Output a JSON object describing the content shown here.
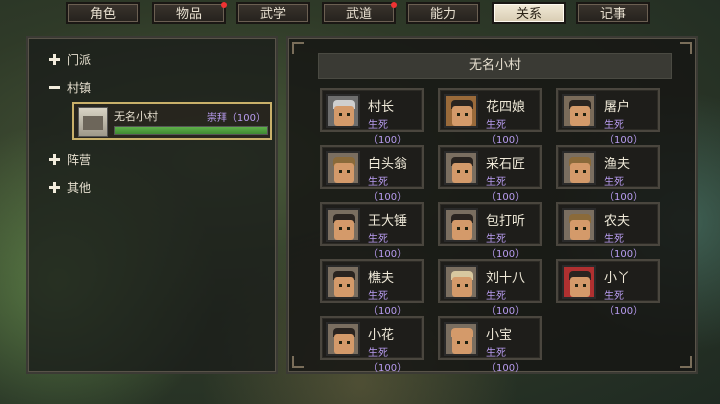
{
  "tabs": [
    {
      "label": "角色",
      "active": false,
      "dot": false
    },
    {
      "label": "物品",
      "active": false,
      "dot": true
    },
    {
      "label": "武学",
      "active": false,
      "dot": false
    },
    {
      "label": "武道",
      "active": false,
      "dot": true
    },
    {
      "label": "能力",
      "active": false,
      "dot": false
    },
    {
      "label": "关系",
      "active": true,
      "dot": false
    },
    {
      "label": "记事",
      "active": false,
      "dot": false
    }
  ],
  "tree": {
    "sect": "门派",
    "village": "村镇",
    "faction": "阵营",
    "other": "其他"
  },
  "village_card": {
    "name": "无名小村",
    "relation": "崇拜（100）",
    "progress": 1.0
  },
  "panel": {
    "title": "无名小村",
    "npcs": [
      {
        "name": "村长",
        "relation": "生死（100）",
        "portrait": "village-chief-portrait",
        "bg": "#6e6e6e",
        "hair": "#cfcfcf"
      },
      {
        "name": "花四娘",
        "relation": "生死（100）",
        "portrait": "hua-siniang-portrait",
        "bg": "#9a6a3a",
        "hair": "#2a2420"
      },
      {
        "name": "屠户",
        "relation": "生死（100）",
        "portrait": "butcher-portrait",
        "bg": "#7a6b5a",
        "hair": "#2a2420"
      },
      {
        "name": "白头翁",
        "relation": "生死（100）",
        "portrait": "old-man-portrait",
        "bg": "#7a6e60",
        "hair": "#8a6a3a"
      },
      {
        "name": "采石匠",
        "relation": "生死（100）",
        "portrait": "stonemason-portrait",
        "bg": "#7a6e60",
        "hair": "#2a2420"
      },
      {
        "name": "渔夫",
        "relation": "生死（100）",
        "portrait": "fisherman-portrait",
        "bg": "#7a6e60",
        "hair": "#8a6a3a"
      },
      {
        "name": "王大锤",
        "relation": "生死（100）",
        "portrait": "wang-dachui-portrait",
        "bg": "#7a6e60",
        "hair": "#2a2420"
      },
      {
        "name": "包打听",
        "relation": "生死（100）",
        "portrait": "bao-dating-portrait",
        "bg": "#7a6e60",
        "hair": "#2a2420"
      },
      {
        "name": "农夫",
        "relation": "生死（100）",
        "portrait": "farmer-portrait",
        "bg": "#7a6e60",
        "hair": "#8a6a3a"
      },
      {
        "name": "樵夫",
        "relation": "生死（100）",
        "portrait": "woodcutter-portrait",
        "bg": "#7a6e60",
        "hair": "#2a2420"
      },
      {
        "name": "刘十八",
        "relation": "生死（100）",
        "portrait": "liu-shiba-portrait",
        "bg": "#7a6e60",
        "hair": "#d8c8a0"
      },
      {
        "name": "小丫",
        "relation": "生死（100）",
        "portrait": "xiaoya-portrait",
        "bg": "#b03030",
        "hair": "#2a2420"
      },
      {
        "name": "小花",
        "relation": "生死（100）",
        "portrait": "xiaohua-portrait",
        "bg": "#7a6e60",
        "hair": "#2a2420"
      },
      {
        "name": "小宝",
        "relation": "生死（100）",
        "portrait": "xiaobao-portrait",
        "bg": "#7a6e60",
        "hair": "#d49a6a"
      }
    ]
  }
}
